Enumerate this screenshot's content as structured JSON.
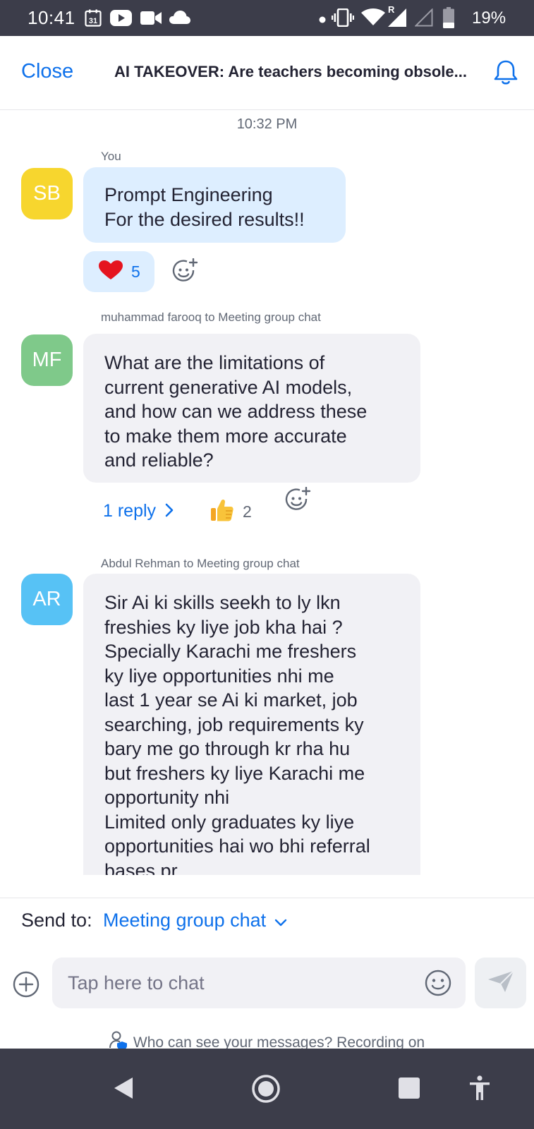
{
  "status_bar": {
    "time": "10:41",
    "calendar_day": "31",
    "battery_percent": "19%",
    "roaming_indicator": "R",
    "icons": [
      "calendar-icon",
      "youtube-icon",
      "video-camera-icon",
      "cloud-icon",
      "dot-icon",
      "vibrate-icon",
      "wifi-icon",
      "signal-icon",
      "signal-empty-icon",
      "battery-icon"
    ]
  },
  "header": {
    "close_label": "Close",
    "title": "AI TAKEOVER: Are teachers becoming obsole...",
    "bell_icon": "bell-icon"
  },
  "chat": {
    "timestamp": "10:32 PM",
    "messages": [
      {
        "sender": "You",
        "avatar_initials": "SB",
        "avatar_color": "#f7d62e",
        "bubble_color": "#ddeeff",
        "lines": [
          "Prompt Engineering",
          "For the desired results!!"
        ],
        "reaction": {
          "emoji_icon": "heart-icon",
          "count": "5"
        }
      },
      {
        "sender": "muhammad farooq to Meeting group chat",
        "avatar_initials": "MF",
        "avatar_color": "#7fc98a",
        "bubble_color": "#f1f1f5",
        "lines": [
          "What are the limitations of",
          "current generative AI models,",
          "and how can we address these",
          "to make them more accurate",
          "and reliable?"
        ],
        "reply_label": "1 reply",
        "reaction": {
          "emoji_icon": "thumbs-up-icon",
          "count": "2"
        }
      },
      {
        "sender": "Abdul Rehman to Meeting group chat",
        "avatar_initials": "AR",
        "avatar_color": "#57c2f5",
        "bubble_color": "#f1f1f5",
        "lines": [
          "Sir Ai ki skills seekh to ly lkn",
          "freshies ky liye job kha hai ?",
          "Specially Karachi me freshers",
          "ky liye opportunities nhi me",
          "last 1 year se Ai ki market, job",
          "searching, job requirements ky",
          "bary me go through kr rha hu",
          "but freshers ky liye Karachi me",
          "opportunity nhi",
          "Limited only graduates ky liye",
          "opportunities hai wo bhi referral",
          "bases pr"
        ]
      }
    ]
  },
  "composer": {
    "send_to_label": "Send to:",
    "send_to_target": "Meeting group chat",
    "input_placeholder": "Tap here to chat",
    "privacy_text": "Who can see your messages? Recording on"
  },
  "colors": {
    "accent": "#0e71eb",
    "status_bar_bg": "#3c3d4a",
    "text_primary": "#232333",
    "text_secondary": "#616875"
  }
}
